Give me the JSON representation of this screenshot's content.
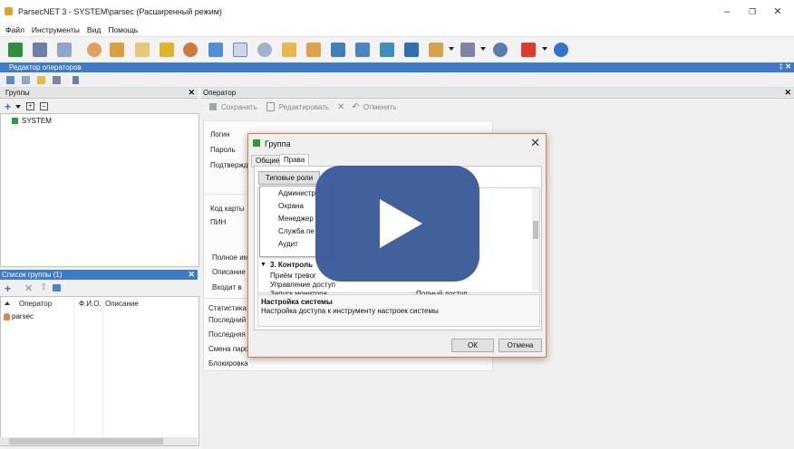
{
  "window": {
    "title": "ParsecNET 3 - SYSTEM\\parsec (Расширенный режим)"
  },
  "menu": [
    "Файл",
    "Инструменты",
    "Вид",
    "Помощь"
  ],
  "editor_bar": {
    "title": "Редактор операторов"
  },
  "groups_panel": {
    "title": "Группы",
    "tree": [
      "SYSTEM"
    ]
  },
  "group_list_panel": {
    "title": "Список группы (1)",
    "columns": [
      "Оператор",
      "Ф.И.О.",
      "Описание"
    ],
    "rows": [
      {
        "operator": "parsec"
      }
    ]
  },
  "operator_panel": {
    "title": "Оператор",
    "toolbar": {
      "save": "Сохранить",
      "edit": "Редактировать",
      "cancel": "Отменить"
    },
    "fields": [
      "Логин",
      "Пароль",
      "Подтвержд",
      "Код карты",
      "ПИН",
      "Полное имя",
      "Описание",
      "Входит в",
      "Статистика",
      "Последний вх",
      "Последняя а",
      "Смена пароля",
      "Блокировка"
    ]
  },
  "dialog": {
    "title": "Группа",
    "tabs": [
      "Общие",
      "Права"
    ],
    "active_tab": "Права",
    "roles_button": "Типовые роли",
    "roles": [
      "Администр",
      "Охрана",
      "Менеджер",
      "Служба пе",
      "Аудит"
    ],
    "tree_section": "3. Контроль",
    "tree_items": [
      "Приём тревог",
      "Управление доступ",
      "Запуск монитора"
    ],
    "access_value": "Полный доступ",
    "info_title": "Настройка системы",
    "info_text": "Настройка доступа к инструменту настроек системы",
    "ok": "ОК",
    "cancel": "Отмена"
  },
  "colors": {
    "accent": "#3e7cc6",
    "play_overlay": "#3a5a99",
    "dialog_border": "#e27a3a"
  }
}
